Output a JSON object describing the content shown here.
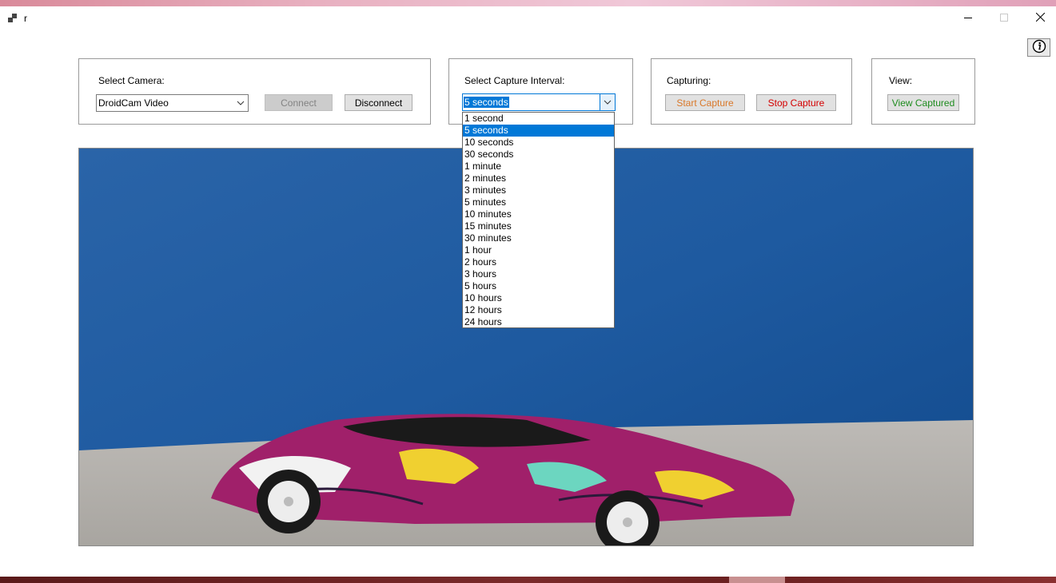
{
  "window": {
    "title": "r"
  },
  "camera_group": {
    "label": "Select Camera:",
    "selected_camera": "DroidCam Video",
    "connect_label": "Connect",
    "disconnect_label": "Disconnect"
  },
  "interval_group": {
    "label": "Select Capture Interval:",
    "selected_interval": "5 seconds",
    "options": [
      "1 second",
      "5 seconds",
      "10 seconds",
      "30 seconds",
      "1 minute",
      "2 minutes",
      "3 minutes",
      "5 minutes",
      "10 minutes",
      "15 minutes",
      "30 minutes",
      "1 hour",
      "2 hours",
      "3 hours",
      "5 hours",
      "10 hours",
      "12 hours",
      "24 hours"
    ]
  },
  "capture_group": {
    "label": "Capturing:",
    "start_label": "Start Capture",
    "stop_label": "Stop Capture"
  },
  "view_group": {
    "label": "View:",
    "view_captured_label": "View Captured"
  },
  "icons": {
    "app": "app-icon",
    "minimize": "minimize-icon",
    "maximize": "maximize-icon",
    "close": "close-icon",
    "info": "info-icon",
    "dropdown": "chevron-down-icon"
  },
  "colors": {
    "start_capture_text": "#d9782a",
    "stop_capture_text": "#d40000",
    "view_captured_text": "#1e8c1e",
    "selection": "#0078d7"
  }
}
